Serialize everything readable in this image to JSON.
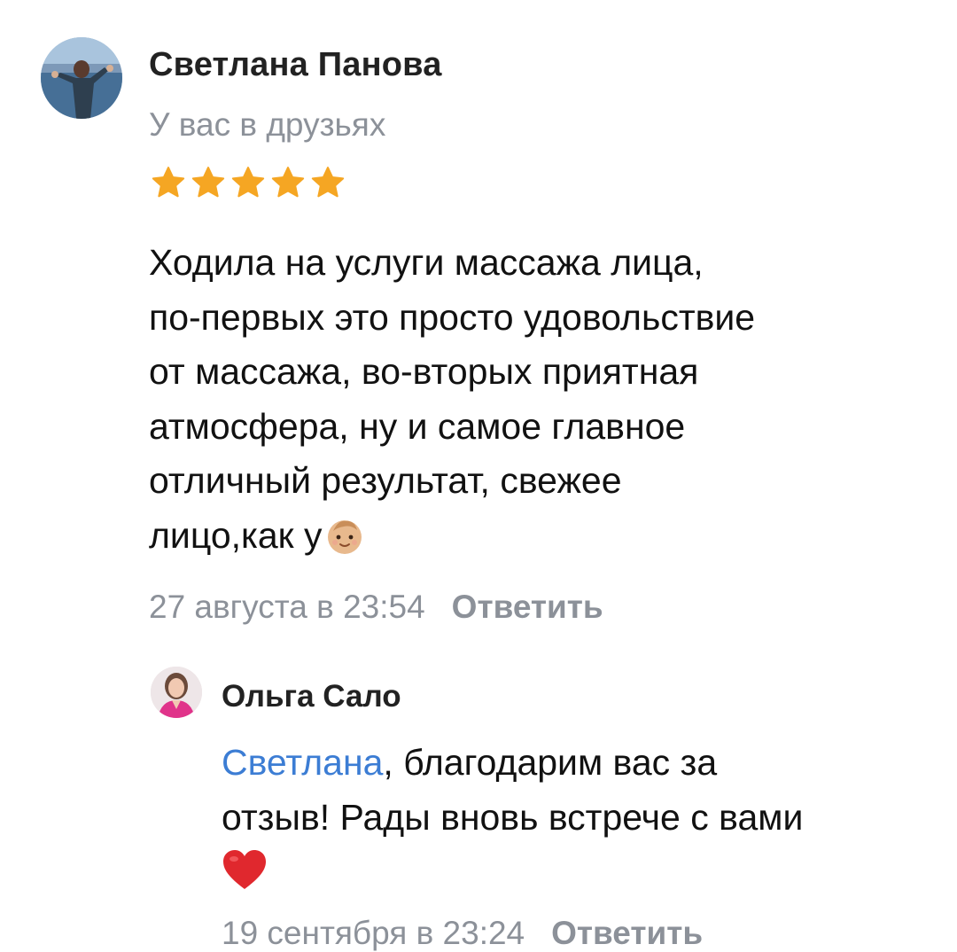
{
  "review": {
    "author_name": "Светлана Панова",
    "friend_status": "У вас в друзьях",
    "rating": 5,
    "rating_max": 5,
    "text_lines": [
      "Ходила на услуги массажа лица,",
      "по-первых это просто удовольствие",
      "от массажа, во-вторых приятная",
      "атмосфера, ну и самое главное",
      "отличный результат, свежее",
      "лицо,как у"
    ],
    "emoji": "baby-face",
    "date": "27 августа в 23:54",
    "reply_action": "Ответить"
  },
  "reply": {
    "author_name": "Ольга Сало",
    "mention": "Светлана",
    "text_line1_rest": ", благодарим вас за",
    "text_line2": "отзыв! Рады вновь встрече с вами",
    "emoji": "red-heart",
    "date": "19 сентября в 23:24",
    "reply_action": "Ответить"
  },
  "colors": {
    "star": "#f5a623",
    "secondary_text": "#8c9199",
    "mention_link": "#3c7dd4",
    "heart": "#e0282e"
  }
}
